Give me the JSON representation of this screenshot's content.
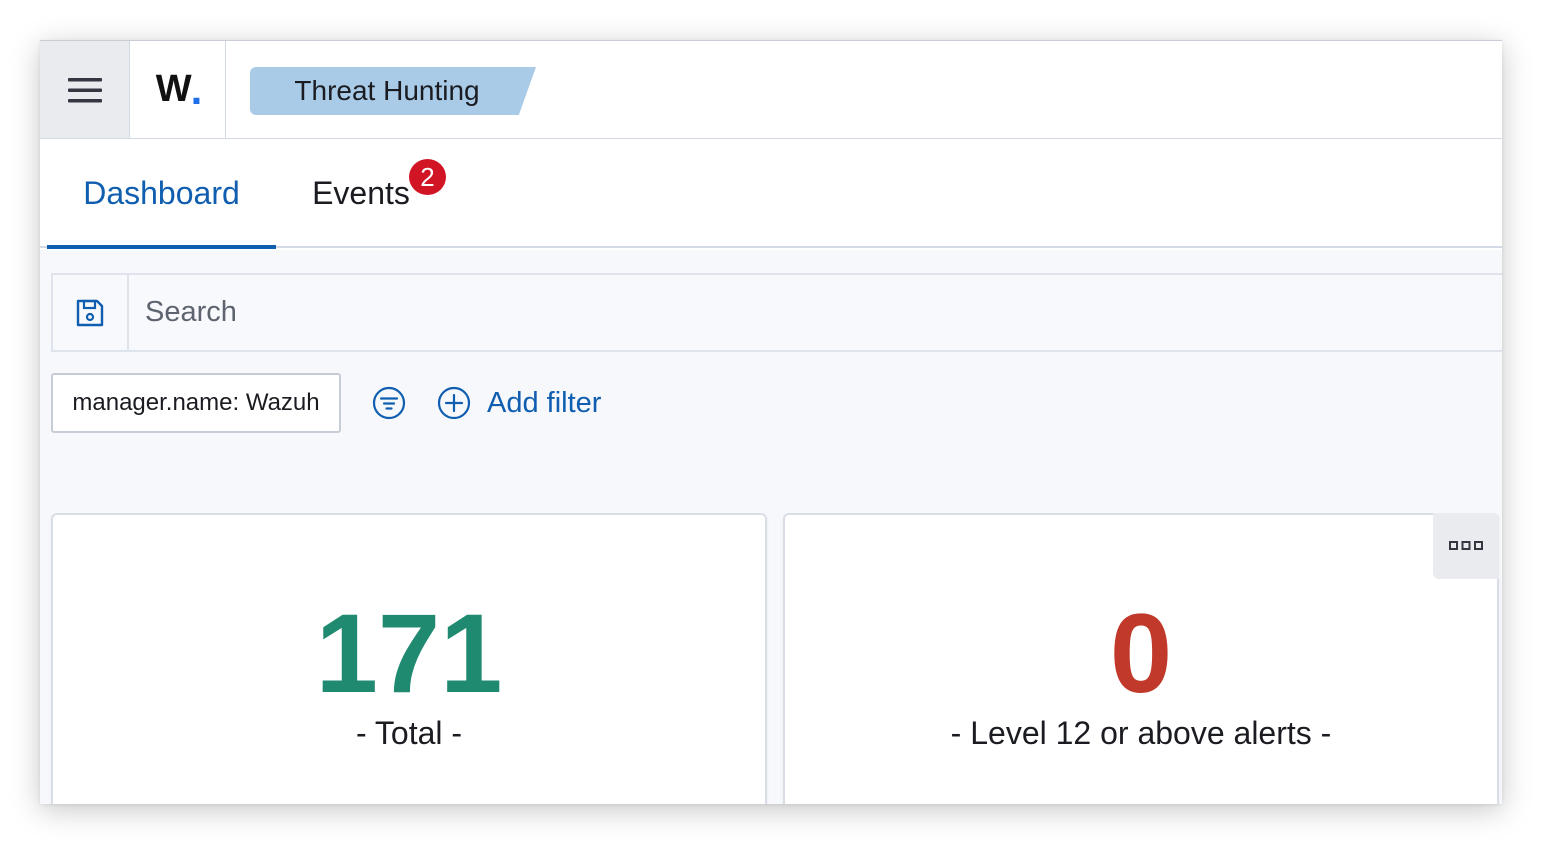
{
  "header": {
    "logo_text": "W",
    "logo_dot": ".",
    "breadcrumb": "Threat Hunting"
  },
  "tabs": [
    {
      "label": "Dashboard",
      "active": true
    },
    {
      "label": "Events",
      "badge": "2"
    }
  ],
  "search": {
    "placeholder": "Search",
    "value": ""
  },
  "filters": {
    "pill": "manager.name: Wazuh",
    "add_label": "Add filter"
  },
  "metrics": [
    {
      "value": "171",
      "label": "- Total -",
      "color": "#1f8a70"
    },
    {
      "value": "0",
      "label": "- Level 12 or above alerts -",
      "color": "#c0392b"
    }
  ],
  "colors": {
    "accent": "#0f5eb0",
    "badge": "#d21524",
    "breadcrumb_bg": "#a9cbe7"
  },
  "icons": {
    "menu": "hamburger-icon",
    "save": "save-icon",
    "filter_menu": "filter-icon",
    "add_filter": "plus-circle-icon",
    "panel_options": "more-horizontal-icon"
  }
}
